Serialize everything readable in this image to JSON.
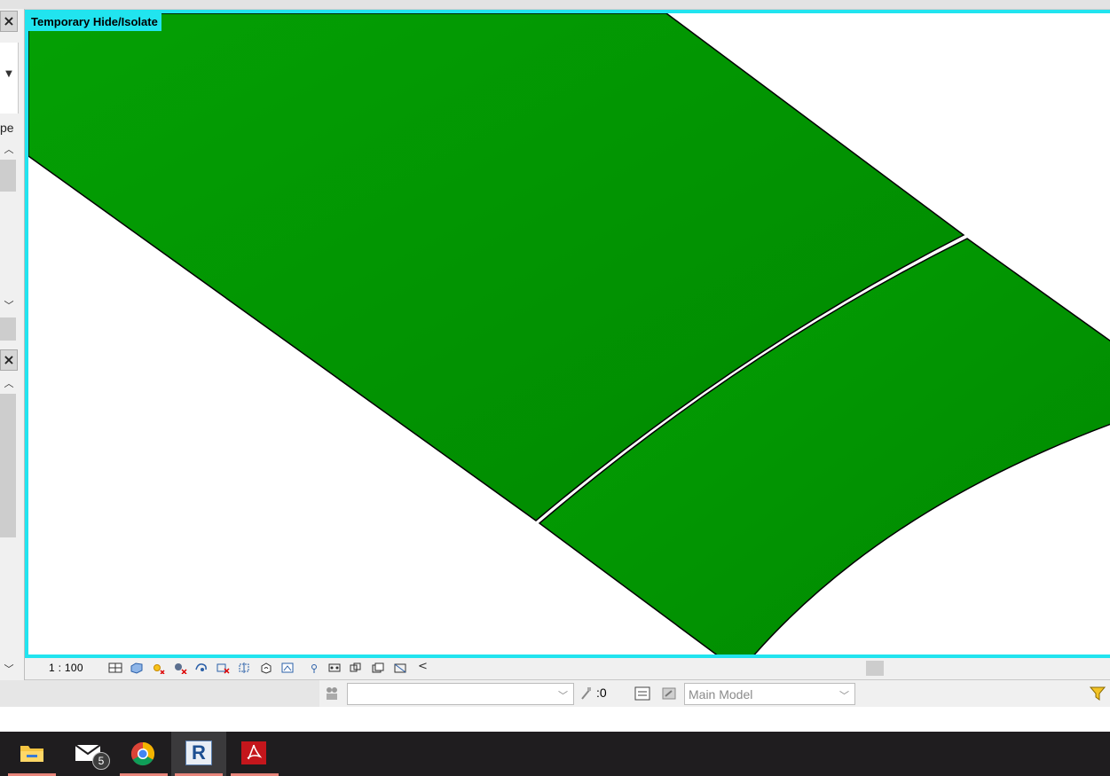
{
  "viewport": {
    "temporary_label": "Temporary Hide/Isolate",
    "border_color": "#21e4ef",
    "surface_color": "#009900"
  },
  "left_panel": {
    "close_icon": "close-icon",
    "partial_text": "pe",
    "dropdown_icon": "chevron-down-icon"
  },
  "view_bar": {
    "scale": "1 : 100",
    "icons": [
      "detail-level-icon",
      "visual-style-icon",
      "sun-path-icon",
      "shadows-icon",
      "show-rendering-icon",
      "crop-view-icon",
      "show-crop-region-icon",
      "unlock-3d-view-icon",
      "temporary-hide-isolate-icon",
      "reveal-hidden-icon",
      "analytical-model-icon",
      "highlight-displacement-icon",
      "reveal-constraints-icon",
      "worksharing-display-icon"
    ],
    "scroll_left_icon": "chevron-left-icon"
  },
  "status_bar": {
    "workset_value": "",
    "editable_count": ":0",
    "design_option": "Main Model",
    "filter_icon": "filter-icon"
  },
  "taskbar": {
    "apps": [
      "file-explorer-icon",
      "mail-icon",
      "chrome-icon",
      "revit-icon",
      "acrobat-icon"
    ],
    "mail_badge": "5",
    "revit_letter": "R"
  }
}
